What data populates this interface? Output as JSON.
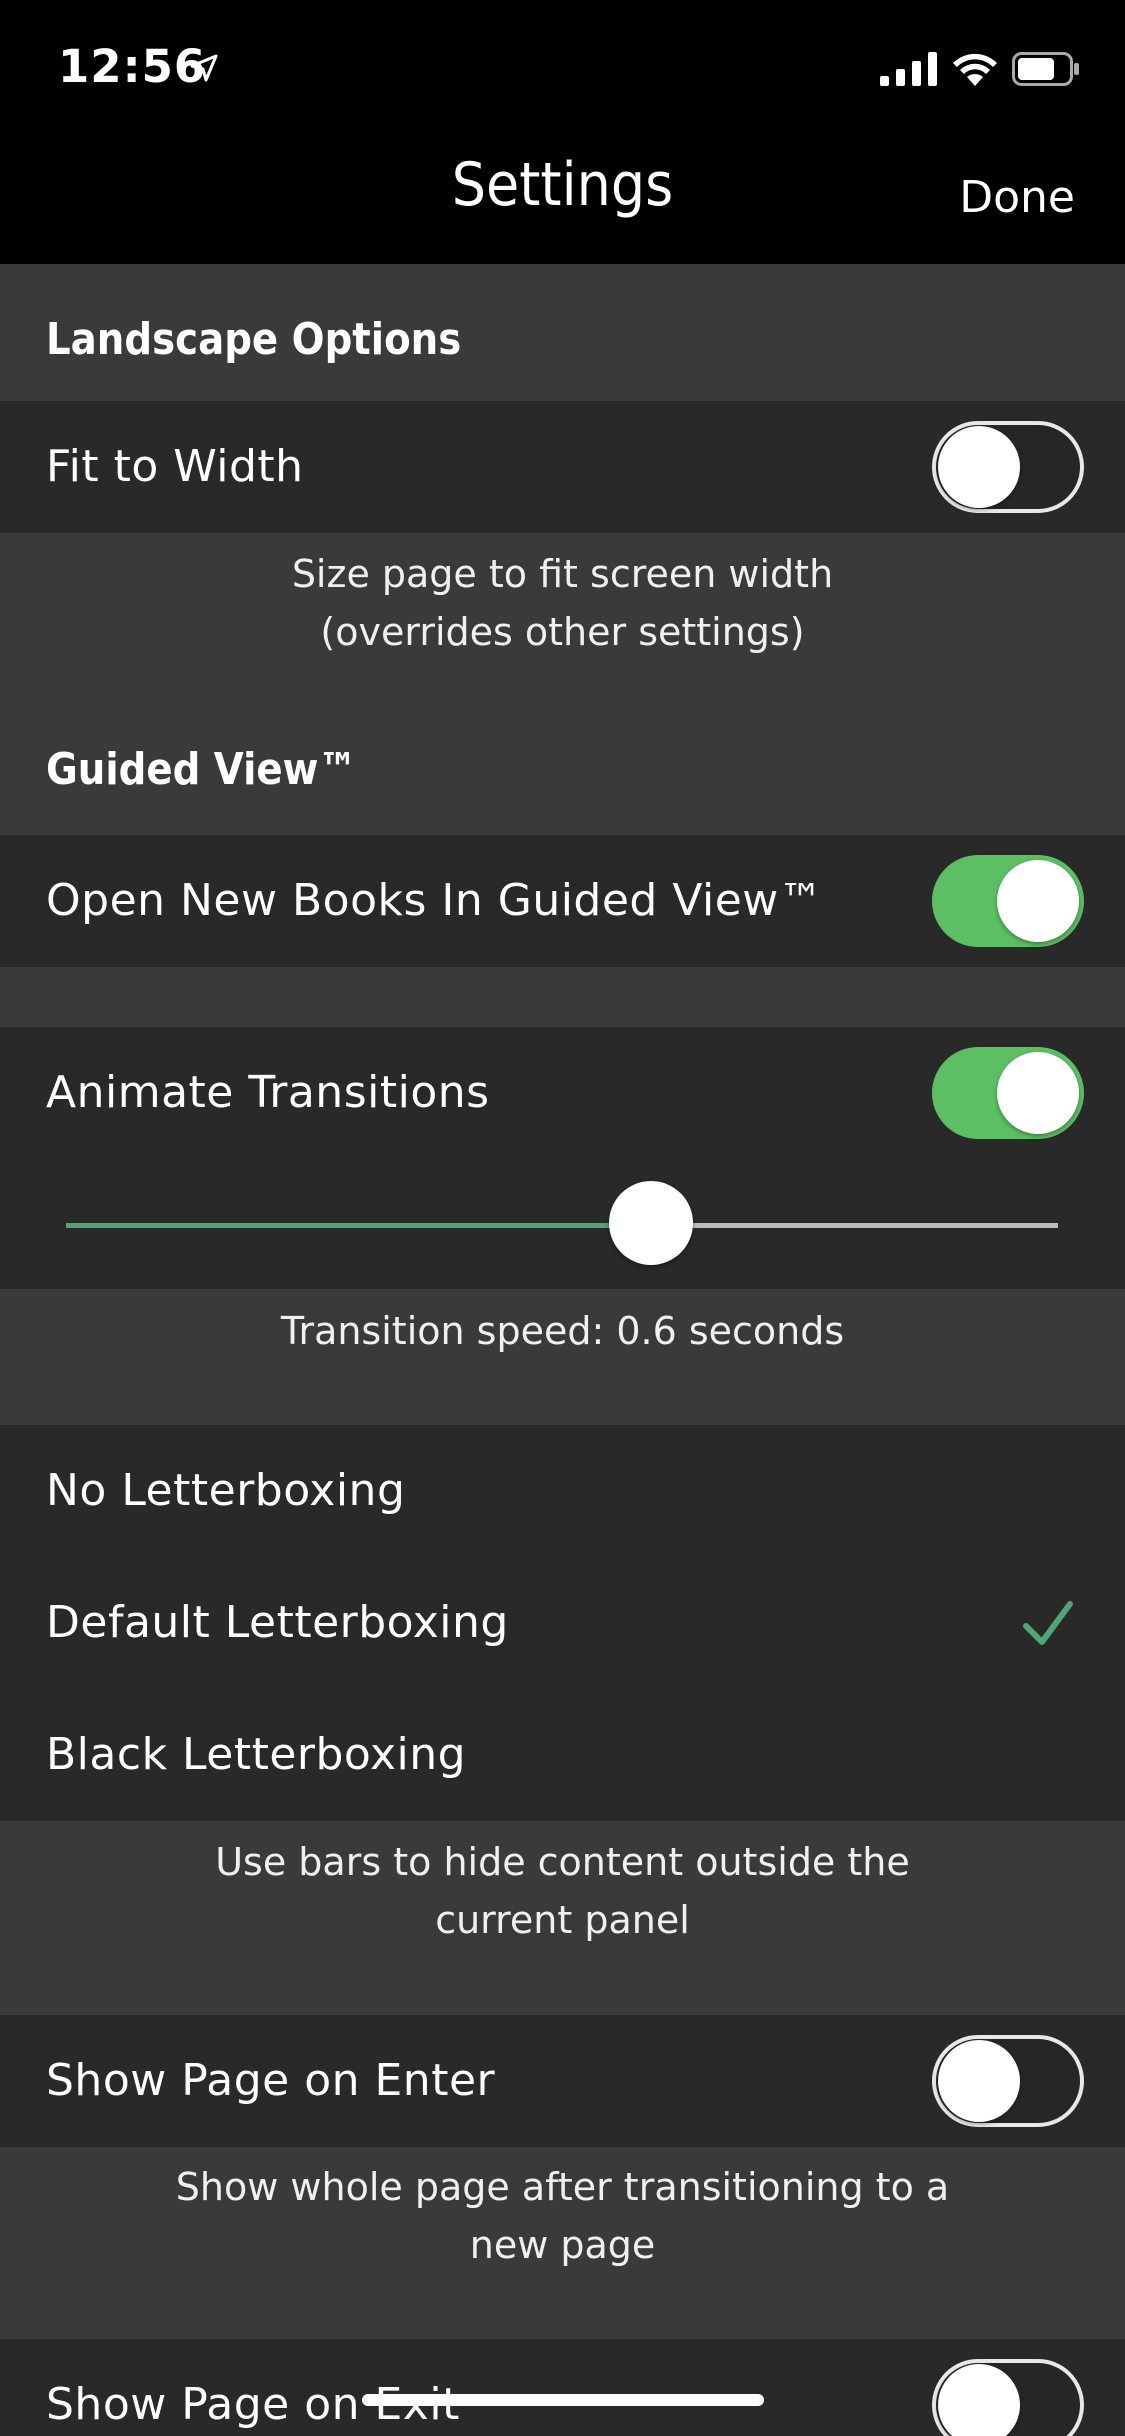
{
  "status_bar": {
    "time": "12:56"
  },
  "nav": {
    "title": "Settings",
    "done_label": "Done"
  },
  "landscape": {
    "header": "Landscape Options",
    "fit_to_width": {
      "label": "Fit to Width",
      "on": false
    },
    "footer_line1": "Size page to fit screen width",
    "footer_line2": "(overrides other settings)"
  },
  "guided_view": {
    "header": "Guided View™",
    "open_new_books": {
      "label": "Open New Books In Guided View™",
      "on": true
    }
  },
  "animate": {
    "label": "Animate Transitions",
    "on": true,
    "slider_fraction": 0.6,
    "caption": "Transition speed: 0.6 seconds"
  },
  "letterboxing": {
    "options": [
      "No Letterboxing",
      "Default Letterboxing",
      "Black Letterboxing"
    ],
    "selected": "Default Letterboxing",
    "footer_line1": "Use bars to hide content outside the",
    "footer_line2": "current panel"
  },
  "show_page_on_enter": {
    "label": "Show Page on Enter",
    "on": false,
    "footer_line1": "Show whole page after transitioning to a",
    "footer_line2": "new page"
  },
  "show_page_on_exit": {
    "label": "Show Page on Exit",
    "on": false
  },
  "colors": {
    "accent_green": "#5cbf64",
    "check_green": "#4fa57a",
    "row_bg": "#292929",
    "section_bg": "#3a3a3a"
  }
}
